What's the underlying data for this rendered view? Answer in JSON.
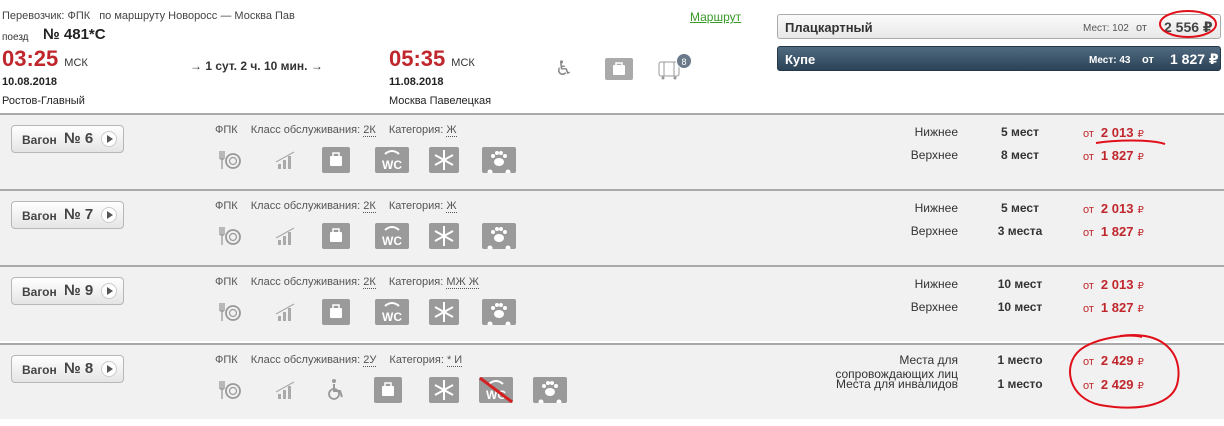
{
  "header": {
    "carrier": "Перевозчик: ФПК",
    "route": "по маршруту Новоросс — Москва Пав",
    "route_link": "Маршрут",
    "train_label": "поезд",
    "train_number": "№ 481*С",
    "departure": {
      "time": "03:25",
      "tz": "МСК",
      "date": "10.08.2018",
      "station": "Ростов-Главный"
    },
    "duration": "→ 1 сут. 2 ч. 10 мин. →",
    "arrival": {
      "time": "05:35",
      "tz": "МСК",
      "date": "11.08.2018",
      "station": "Москва Павелецкая"
    },
    "luggage_badge": "8",
    "wheelchair_icon": "♿"
  },
  "classes": [
    {
      "name": "Плацкартный",
      "seats": "Мест: 102",
      "from": "от",
      "price": "2 556 ₽",
      "selected": false
    },
    {
      "name": "Купе",
      "seats": "Мест: 43",
      "from": "от",
      "price": "1 827 ₽",
      "selected": true
    }
  ],
  "wagons": [
    {
      "label": "Вагон",
      "number": "№ 6",
      "carrier": "ФПК",
      "class_label": "Класс обслуживания:",
      "class": "2К",
      "cat_label": "Категория:",
      "category": "Ж",
      "icons": [
        "food-icon",
        "chart-icon",
        "bag-icon",
        "wc-icon",
        "snowflake-icon",
        "pet-icon"
      ],
      "seats": [
        {
          "type": "Нижнее",
          "count": "5 мест",
          "from": "от",
          "price": "2 013",
          "currency": "₽"
        },
        {
          "type": "Верхнее",
          "count": "8 мест",
          "from": "от",
          "price": "1 827",
          "currency": "₽"
        }
      ]
    },
    {
      "label": "Вагон",
      "number": "№ 7",
      "carrier": "ФПК",
      "class_label": "Класс обслуживания:",
      "class": "2К",
      "cat_label": "Категория:",
      "category": "Ж",
      "icons": [
        "food-icon",
        "chart-icon",
        "bag-icon",
        "wc-icon",
        "snowflake-icon",
        "pet-icon"
      ],
      "seats": [
        {
          "type": "Нижнее",
          "count": "5 мест",
          "from": "от",
          "price": "2 013",
          "currency": "₽"
        },
        {
          "type": "Верхнее",
          "count": "3 места",
          "from": "от",
          "price": "1 827",
          "currency": "₽"
        }
      ]
    },
    {
      "label": "Вагон",
      "number": "№ 9",
      "carrier": "ФПК",
      "class_label": "Класс обслуживания:",
      "class": "2К",
      "cat_label": "Категория:",
      "category": "МЖ Ж",
      "icons": [
        "food-icon",
        "chart-icon",
        "bag-icon",
        "wc-icon",
        "snowflake-icon",
        "pet-icon"
      ],
      "seats": [
        {
          "type": "Нижнее",
          "count": "10 мест",
          "from": "от",
          "price": "2 013",
          "currency": "₽"
        },
        {
          "type": "Верхнее",
          "count": "10 мест",
          "from": "от",
          "price": "1 827",
          "currency": "₽"
        }
      ]
    },
    {
      "label": "Вагон",
      "number": "№ 8",
      "carrier": "ФПК",
      "class_label": "Класс обслуживания:",
      "class": "2У",
      "cat_label": "Категория:",
      "category": "* И",
      "icons": [
        "food-icon",
        "chart-icon",
        "wheelchair-icon",
        "bag-icon",
        "snowflake-icon",
        "wc-disabled-icon",
        "pet-icon"
      ],
      "seats": [
        {
          "type": "Места для сопровождающих лиц",
          "count": "1 место",
          "from": "от",
          "price": "2 429",
          "currency": "₽"
        },
        {
          "type": "Места для инвалидов",
          "count": "1 место",
          "from": "от",
          "price": "2 429",
          "currency": "₽"
        }
      ]
    }
  ],
  "colors": {
    "price": "#c0272d",
    "selected_class": "#3a5268",
    "route_link": "#3a9a2a",
    "annotation": "#e0101a"
  }
}
